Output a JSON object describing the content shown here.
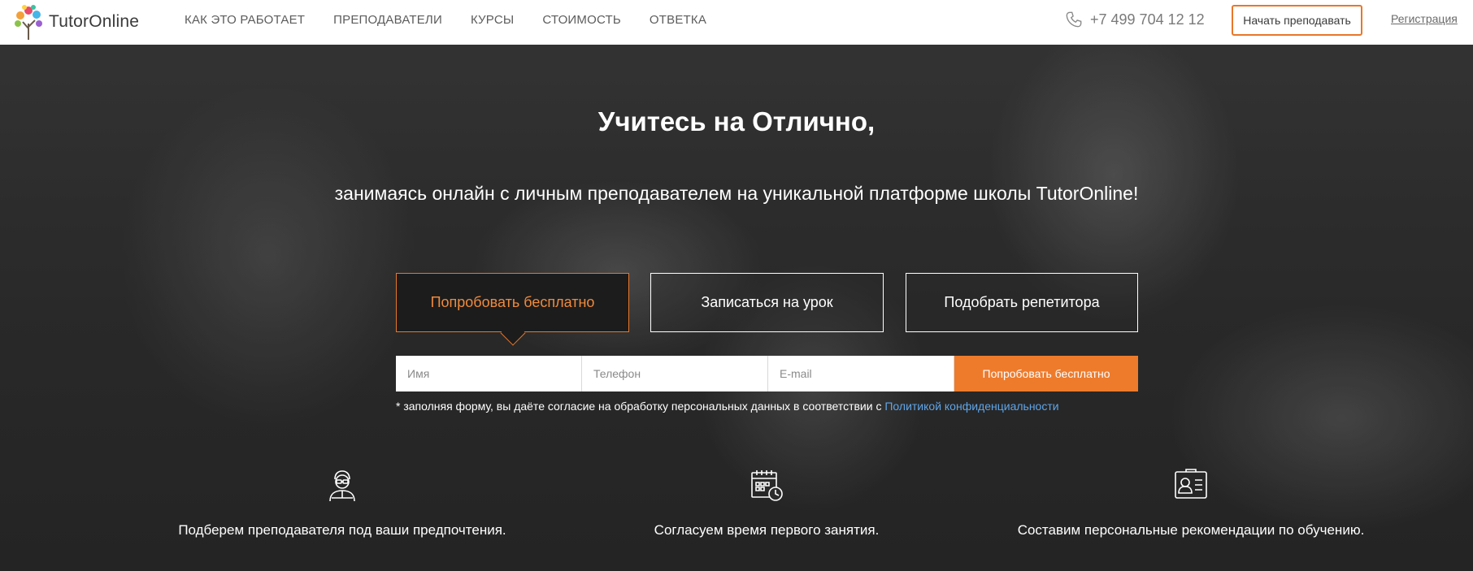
{
  "brand": {
    "name": "TutorOnline",
    "accent": "#e8772a",
    "link_color": "#5fa5e8"
  },
  "nav": {
    "items": [
      {
        "label": "КАК ЭТО РАБОТАЕТ"
      },
      {
        "label": "ПРЕПОДАВАТЕЛИ"
      },
      {
        "label": "КУРСЫ"
      },
      {
        "label": "СТОИМОСТЬ"
      },
      {
        "label": "ОТВЕТКА"
      }
    ]
  },
  "header": {
    "phone": "+7 499 704 12 12",
    "phone_icon": "phone-icon",
    "teach_button": "Начать преподавать",
    "register_link": "Регистрация"
  },
  "hero": {
    "title": "Учитесь на Отлично,",
    "subtitle": "занимаясь онлайн с личным преподавателем на уникальной платформе школы TutorOnline!",
    "tabs": [
      {
        "label": "Попробовать бесплатно",
        "active": true
      },
      {
        "label": "Записаться на урок",
        "active": false
      },
      {
        "label": "Подобрать репетитора",
        "active": false
      }
    ],
    "form": {
      "name_placeholder": "Имя",
      "phone_placeholder": "Телефон",
      "email_placeholder": "E-mail",
      "submit_label": "Попробовать бесплатно"
    },
    "consent": {
      "text": "* заполняя форму, вы даёте согласие на обработку персональных данных в соответствии с",
      "link": "Политикой конфиденциальности"
    },
    "features": [
      {
        "icon": "teacher-icon",
        "text": "Подберем преподавателя под ваши предпочтения."
      },
      {
        "icon": "calendar-clock-icon",
        "text": "Согласуем время первого занятия."
      },
      {
        "icon": "profile-card-icon",
        "text": "Составим персональные рекомендации по обучению."
      }
    ]
  }
}
